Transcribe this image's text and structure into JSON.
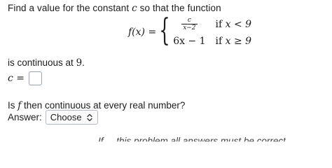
{
  "question": {
    "prompt_prefix": "Find a value for the constant ",
    "prompt_var": "c",
    "prompt_suffix": " so that the function",
    "function_lhs": "f(x) =",
    "case1_num": "c",
    "case1_den": "x−2",
    "case1_cond_if": "if ",
    "case1_cond": "x < 9",
    "case2_expr": "6x − 1",
    "case2_cond_if": "if ",
    "case2_cond": "x ≥ 9",
    "continuous_text": "is continuous at ",
    "continuous_point": "9",
    "continuous_end": ".",
    "c_label": "c =",
    "c_value": ""
  },
  "part2": {
    "question_prefix": "Is ",
    "question_var": "f",
    "question_suffix": " then continuous at every real number?",
    "answer_label": "Answer:",
    "select_value": "Choose"
  },
  "footer": {
    "text": "If ... this problem all answers must be correct"
  },
  "icons": {
    "select": "chevron-updown-icon"
  }
}
